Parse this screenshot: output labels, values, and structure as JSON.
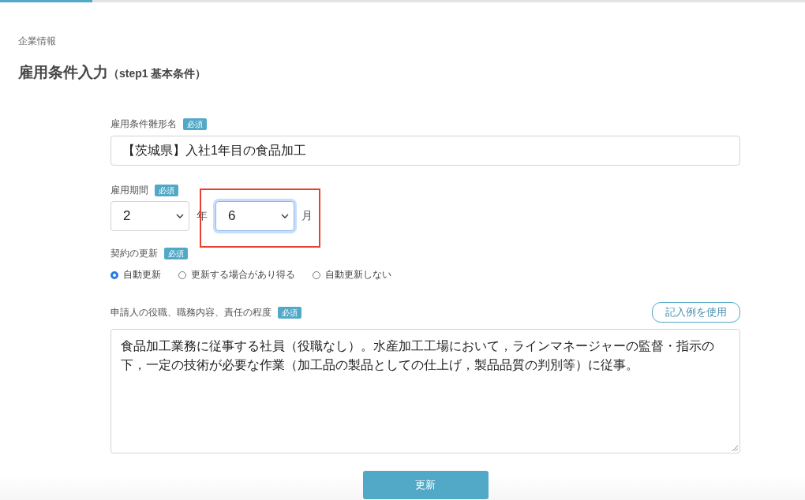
{
  "progress": {
    "level": 0.115
  },
  "breadcrumb": "企業情報",
  "heading": {
    "title": "雇用条件入力",
    "subtitle": "（step1 基本条件）"
  },
  "template_name": {
    "label": "雇用条件雛形名",
    "badge": "必須",
    "value": "【茨城県】入社1年目の食品加工"
  },
  "period": {
    "label": "雇用期間",
    "badge": "必須",
    "year": {
      "value": "2",
      "unit": "年",
      "focused": false,
      "highlighted": false
    },
    "month": {
      "value": "6",
      "unit": "月",
      "focused": true,
      "highlighted": true
    }
  },
  "renewal": {
    "label": "契約の更新",
    "badge": "必須",
    "options": [
      {
        "label": "自動更新",
        "selected": true
      },
      {
        "label": "更新する場合があり得る",
        "selected": false
      },
      {
        "label": "自動更新しない",
        "selected": false
      }
    ]
  },
  "duties": {
    "label": "申請人の役職、職務内容、責任の程度",
    "badge": "必須",
    "example_button": "記入例を使用",
    "value": "食品加工業務に従事する社員（役職なし）。水産加工工場において，ラインマネージャーの監督・指示の下，一定の技術が必要な作業（加工品の製品としての仕上げ，製品品質の判別等）に従事。"
  },
  "submit": "更新"
}
